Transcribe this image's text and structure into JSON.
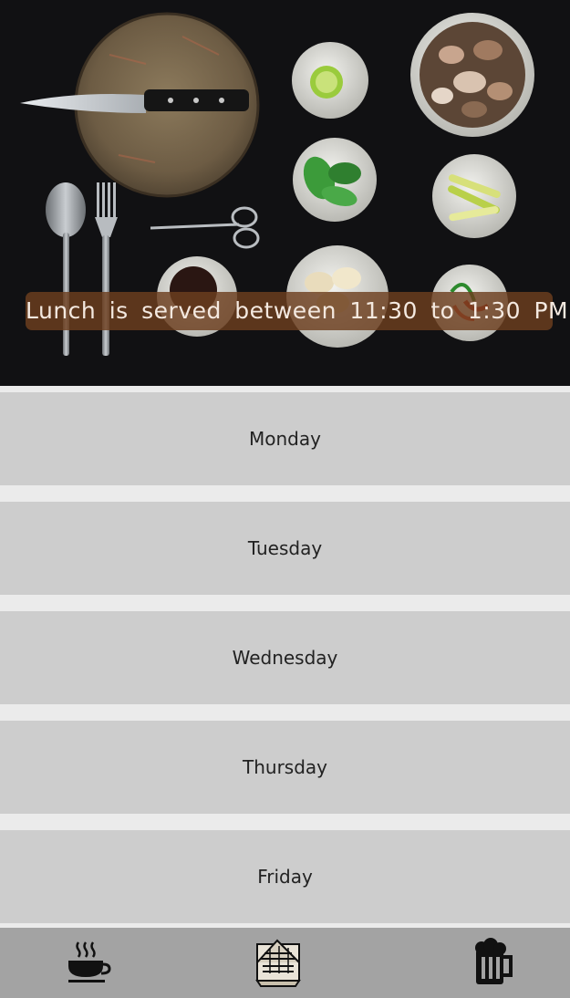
{
  "hero": {
    "banner_text": "Lunch is served between 11:30 to 1:30 PM",
    "image_name": "kitchen-tabletop-photo"
  },
  "days": [
    {
      "label": "Monday"
    },
    {
      "label": "Tuesday"
    },
    {
      "label": "Wednesday"
    },
    {
      "label": "Thursday"
    },
    {
      "label": "Friday"
    }
  ],
  "tabbar": {
    "tabs": [
      {
        "icon": "coffee-cup-icon"
      },
      {
        "icon": "menu-icon"
      },
      {
        "icon": "beer-mug-icon"
      }
    ]
  },
  "colors": {
    "banner_bg": "#6c3e1e",
    "row_bg": "#cdcdcd",
    "gap_bg": "#ebebeb",
    "tabbar_bg": "#a3a3a3"
  }
}
